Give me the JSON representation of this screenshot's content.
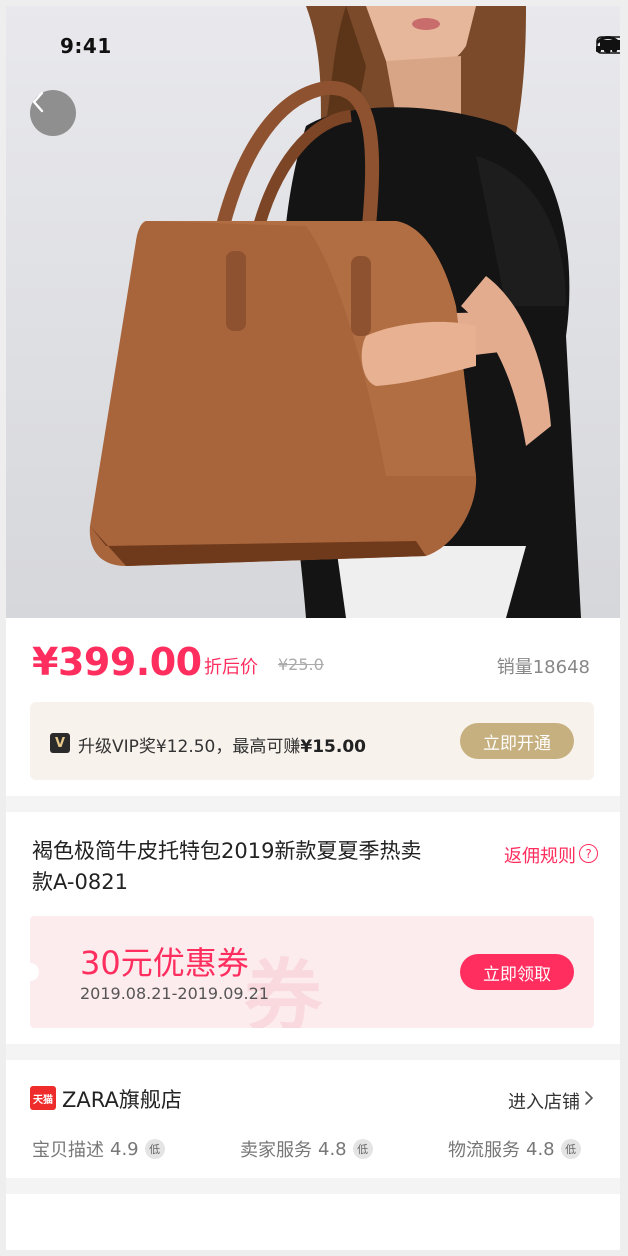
{
  "status_bar": {
    "time": "9:41"
  },
  "product": {
    "price": "¥399.00",
    "price_tag": "折后价",
    "original_price": "¥25.0",
    "sales": "销量18648",
    "title": "褐色极简牛皮托特包2019新款夏夏季热卖款A-0821",
    "rebate_rules": "返佣规则"
  },
  "vip": {
    "badge": "V",
    "text_prefix": "升级VIP奖¥12.50，最高可赚",
    "text_highlight": "¥15.00",
    "button": "立即开通"
  },
  "coupon": {
    "amount": "30元优惠券",
    "valid_dates": "2019.08.21-2019.09.21",
    "watermark": "券",
    "button": "立即领取"
  },
  "store": {
    "logo_text": "天猫",
    "name": "ZARA旗舰店",
    "enter": "进入店铺",
    "ratings": [
      {
        "label": "宝贝描述",
        "score": "4.9",
        "level": "低"
      },
      {
        "label": "卖家服务",
        "score": "4.8",
        "level": "低"
      },
      {
        "label": "物流服务",
        "score": "4.8",
        "level": "低"
      }
    ]
  },
  "colors": {
    "accent": "#ff2e5f",
    "vip_gold": "#c7b07f",
    "bag_brown": "#a8643b"
  },
  "icons": [
    "back-arrow-icon",
    "signal-icon",
    "wifi-icon",
    "battery-icon",
    "question-icon",
    "tmall-logo-icon",
    "chevron-right-icon"
  ]
}
